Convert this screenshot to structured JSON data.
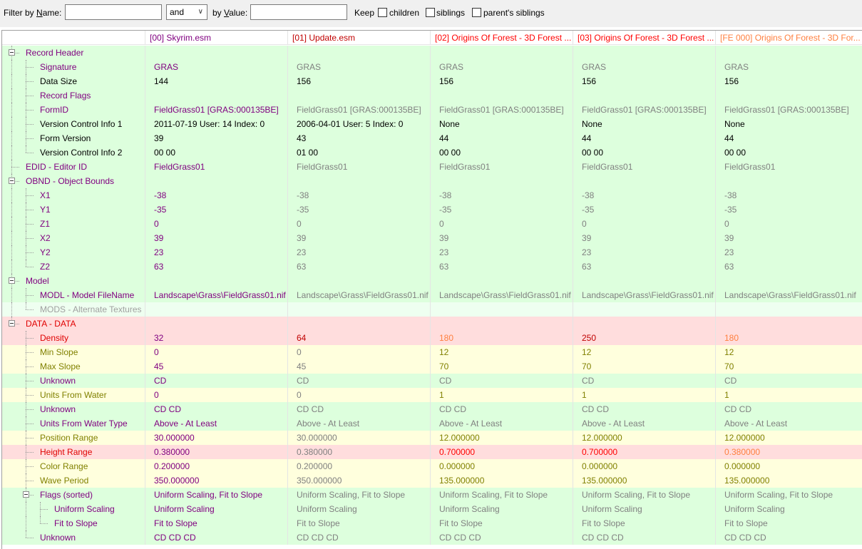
{
  "filter": {
    "name_label": "Filter by ",
    "name_label_key": "N",
    "name_label_tail": "ame:",
    "name_value": "",
    "operator": "and",
    "value_label": "by ",
    "value_label_key": "V",
    "value_label_tail": "alue:",
    "value_value": "",
    "keep_label": "Keep",
    "options": [
      {
        "label": "children",
        "checked": false
      },
      {
        "label": "siblings",
        "checked": false
      },
      {
        "label": "parent's siblings",
        "checked": false
      }
    ]
  },
  "colors": {
    "green_bg": "#ddffdd",
    "yellow_bg": "#ffffdd",
    "red_bg": "#ffdddd",
    "mods_bg": "#eefff0",
    "purple": "#800080",
    "gray": "#808080",
    "red": "#ff0000",
    "orange": "#ff8040",
    "olive": "#808000"
  },
  "columns": [
    {
      "label": "[00] Skyrim.esm",
      "color": "purple"
    },
    {
      "label": "[01] Update.esm",
      "color": "darkred"
    },
    {
      "label": "[02] Origins Of Forest - 3D Forest ...",
      "color": "red"
    },
    {
      "label": "[03] Origins Of Forest - 3D Forest ...",
      "color": "red"
    },
    {
      "label": "[FE 000] Origins Of Forest - 3D For...",
      "color": "orange"
    }
  ],
  "rows": [
    {
      "name": "Record Header",
      "level": 0,
      "expander": true,
      "bg": "green",
      "name_color": "purple",
      "values": [
        "",
        "",
        "",
        "",
        ""
      ],
      "colors": [
        "black",
        "black",
        "black",
        "black",
        "black"
      ]
    },
    {
      "name": "Signature",
      "level": 1,
      "bg": "green",
      "name_color": "purple",
      "values": [
        "GRAS",
        "GRAS",
        "GRAS",
        "GRAS",
        "GRAS"
      ],
      "colors": [
        "purple",
        "gray",
        "gray",
        "gray",
        "gray"
      ]
    },
    {
      "name": "Data Size",
      "level": 1,
      "bg": "green",
      "name_color": "black",
      "values": [
        "144",
        "156",
        "156",
        "156",
        "156"
      ],
      "colors": [
        "black",
        "black",
        "black",
        "black",
        "black"
      ]
    },
    {
      "name": "Record Flags",
      "level": 1,
      "bg": "green",
      "name_color": "purple",
      "values": [
        "",
        "",
        "",
        "",
        ""
      ],
      "colors": [
        "black",
        "black",
        "black",
        "black",
        "black"
      ]
    },
    {
      "name": "FormID",
      "level": 1,
      "bg": "green",
      "name_color": "purple",
      "values": [
        "FieldGrass01 [GRAS:000135BE]",
        "FieldGrass01 [GRAS:000135BE]",
        "FieldGrass01 [GRAS:000135BE]",
        "FieldGrass01 [GRAS:000135BE]",
        "FieldGrass01 [GRAS:000135BE]"
      ],
      "colors": [
        "purple",
        "gray",
        "gray",
        "gray",
        "gray"
      ]
    },
    {
      "name": "Version Control Info 1",
      "level": 1,
      "bg": "green",
      "name_color": "black",
      "values": [
        "2011-07-19 User: 14 Index: 0",
        "2006-04-01 User: 5 Index: 0",
        "None",
        "None",
        "None"
      ],
      "colors": [
        "black",
        "black",
        "black",
        "black",
        "black"
      ]
    },
    {
      "name": "Form Version",
      "level": 1,
      "bg": "green",
      "name_color": "black",
      "values": [
        "39",
        "43",
        "44",
        "44",
        "44"
      ],
      "colors": [
        "black",
        "black",
        "black",
        "black",
        "black"
      ]
    },
    {
      "name": "Version Control Info 2",
      "level": 1,
      "bg": "green",
      "name_color": "black",
      "values": [
        "00 00",
        "01 00",
        "00 00",
        "00 00",
        "00 00"
      ],
      "colors": [
        "black",
        "black",
        "black",
        "black",
        "black"
      ]
    },
    {
      "name": "EDID - Editor ID",
      "level": 0,
      "bg": "green",
      "name_color": "purple",
      "values": [
        "FieldGrass01",
        "FieldGrass01",
        "FieldGrass01",
        "FieldGrass01",
        "FieldGrass01"
      ],
      "colors": [
        "purple",
        "gray",
        "gray",
        "gray",
        "gray"
      ]
    },
    {
      "name": "OBND - Object Bounds",
      "level": 0,
      "expander": true,
      "bg": "green",
      "name_color": "purple",
      "values": [
        "",
        "",
        "",
        "",
        ""
      ],
      "colors": [
        "black",
        "black",
        "black",
        "black",
        "black"
      ]
    },
    {
      "name": "X1",
      "level": 1,
      "bg": "green",
      "name_color": "purple",
      "values": [
        "-38",
        "-38",
        "-38",
        "-38",
        "-38"
      ],
      "colors": [
        "purple",
        "gray",
        "gray",
        "gray",
        "gray"
      ]
    },
    {
      "name": "Y1",
      "level": 1,
      "bg": "green",
      "name_color": "purple",
      "values": [
        "-35",
        "-35",
        "-35",
        "-35",
        "-35"
      ],
      "colors": [
        "purple",
        "gray",
        "gray",
        "gray",
        "gray"
      ]
    },
    {
      "name": "Z1",
      "level": 1,
      "bg": "green",
      "name_color": "purple",
      "values": [
        "0",
        "0",
        "0",
        "0",
        "0"
      ],
      "colors": [
        "purple",
        "gray",
        "gray",
        "gray",
        "gray"
      ]
    },
    {
      "name": "X2",
      "level": 1,
      "bg": "green",
      "name_color": "purple",
      "values": [
        "39",
        "39",
        "39",
        "39",
        "39"
      ],
      "colors": [
        "purple",
        "gray",
        "gray",
        "gray",
        "gray"
      ]
    },
    {
      "name": "Y2",
      "level": 1,
      "bg": "green",
      "name_color": "purple",
      "values": [
        "23",
        "23",
        "23",
        "23",
        "23"
      ],
      "colors": [
        "purple",
        "gray",
        "gray",
        "gray",
        "gray"
      ]
    },
    {
      "name": "Z2",
      "level": 1,
      "bg": "green",
      "name_color": "purple",
      "values": [
        "63",
        "63",
        "63",
        "63",
        "63"
      ],
      "colors": [
        "purple",
        "gray",
        "gray",
        "gray",
        "gray"
      ]
    },
    {
      "name": "Model",
      "level": 0,
      "expander": true,
      "bg": "green",
      "name_color": "purple",
      "values": [
        "",
        "",
        "",
        "",
        ""
      ],
      "colors": [
        "black",
        "black",
        "black",
        "black",
        "black"
      ]
    },
    {
      "name": "MODL - Model FileName",
      "level": 1,
      "bg": "green",
      "name_color": "purple",
      "values": [
        "Landscape\\Grass\\FieldGrass01.nif",
        "Landscape\\Grass\\FieldGrass01.nif",
        "Landscape\\Grass\\FieldGrass01.nif",
        "Landscape\\Grass\\FieldGrass01.nif",
        "Landscape\\Grass\\FieldGrass01.nif"
      ],
      "colors": [
        "purple",
        "gray",
        "gray",
        "gray",
        "gray"
      ]
    },
    {
      "name": "MODS - Alternate Textures",
      "level": 1,
      "bg": "mods",
      "name_color": "mods",
      "values": [
        "",
        "",
        "",
        "",
        ""
      ],
      "colors": [
        "black",
        "black",
        "black",
        "black",
        "black"
      ]
    },
    {
      "name": "DATA - DATA",
      "level": 0,
      "expander": true,
      "bg": "red",
      "name_color": "red",
      "values": [
        "",
        "",
        "",
        "",
        ""
      ],
      "colors": [
        "black",
        "black",
        "black",
        "black",
        "black"
      ]
    },
    {
      "name": "Density",
      "level": 1,
      "bg": "red",
      "name_color": "red",
      "values": [
        "32",
        "64",
        "180",
        "250",
        "180"
      ],
      "colors": [
        "purple",
        "darkred",
        "orange",
        "darkred",
        "orange"
      ]
    },
    {
      "name": "Min Slope",
      "level": 1,
      "bg": "yellow",
      "name_color": "olive",
      "values": [
        "0",
        "0",
        "12",
        "12",
        "12"
      ],
      "colors": [
        "purple",
        "gray",
        "olive",
        "olive",
        "olive"
      ]
    },
    {
      "name": "Max Slope",
      "level": 1,
      "bg": "yellow",
      "name_color": "olive",
      "values": [
        "45",
        "45",
        "70",
        "70",
        "70"
      ],
      "colors": [
        "purple",
        "gray",
        "olive",
        "olive",
        "olive"
      ]
    },
    {
      "name": "Unknown",
      "level": 1,
      "bg": "green",
      "name_color": "purple",
      "values": [
        "CD",
        "CD",
        "CD",
        "CD",
        "CD"
      ],
      "colors": [
        "purple",
        "gray",
        "gray",
        "gray",
        "gray"
      ]
    },
    {
      "name": "Units From Water",
      "level": 1,
      "bg": "yellow",
      "name_color": "olive",
      "values": [
        "0",
        "0",
        "1",
        "1",
        "1"
      ],
      "colors": [
        "purple",
        "gray",
        "olive",
        "olive",
        "olive"
      ]
    },
    {
      "name": "Unknown",
      "level": 1,
      "bg": "green",
      "name_color": "purple",
      "values": [
        "CD CD",
        "CD CD",
        "CD CD",
        "CD CD",
        "CD CD"
      ],
      "colors": [
        "purple",
        "gray",
        "gray",
        "gray",
        "gray"
      ]
    },
    {
      "name": "Units From Water Type",
      "level": 1,
      "bg": "green",
      "name_color": "purple",
      "values": [
        "Above - At Least",
        "Above - At Least",
        "Above - At Least",
        "Above - At Least",
        "Above - At Least"
      ],
      "colors": [
        "purple",
        "gray",
        "gray",
        "gray",
        "gray"
      ]
    },
    {
      "name": "Position Range",
      "level": 1,
      "bg": "yellow",
      "name_color": "olive",
      "values": [
        "30.000000",
        "30.000000",
        "12.000000",
        "12.000000",
        "12.000000"
      ],
      "colors": [
        "purple",
        "gray",
        "olive",
        "olive",
        "olive"
      ]
    },
    {
      "name": "Height Range",
      "level": 1,
      "bg": "red",
      "name_color": "red",
      "values": [
        "0.380000",
        "0.380000",
        "0.700000",
        "0.700000",
        "0.380000"
      ],
      "colors": [
        "purple",
        "gray",
        "red",
        "red",
        "orange"
      ]
    },
    {
      "name": "Color Range",
      "level": 1,
      "bg": "yellow",
      "name_color": "olive",
      "values": [
        "0.200000",
        "0.200000",
        "0.000000",
        "0.000000",
        "0.000000"
      ],
      "colors": [
        "purple",
        "gray",
        "olive",
        "olive",
        "olive"
      ]
    },
    {
      "name": "Wave Period",
      "level": 1,
      "bg": "yellow",
      "name_color": "olive",
      "values": [
        "350.000000",
        "350.000000",
        "135.000000",
        "135.000000",
        "135.000000"
      ],
      "colors": [
        "purple",
        "gray",
        "olive",
        "olive",
        "olive"
      ]
    },
    {
      "name": "Flags (sorted)",
      "level": 1,
      "expander": true,
      "bg": "green",
      "name_color": "purple",
      "values": [
        "Uniform Scaling, Fit to Slope",
        "Uniform Scaling, Fit to Slope",
        "Uniform Scaling, Fit to Slope",
        "Uniform Scaling, Fit to Slope",
        "Uniform Scaling, Fit to Slope"
      ],
      "colors": [
        "purple",
        "gray",
        "gray",
        "gray",
        "gray"
      ]
    },
    {
      "name": "Uniform Scaling",
      "level": 2,
      "bg": "green",
      "name_color": "purple",
      "values": [
        "Uniform Scaling",
        "Uniform Scaling",
        "Uniform Scaling",
        "Uniform Scaling",
        "Uniform Scaling"
      ],
      "colors": [
        "purple",
        "gray",
        "gray",
        "gray",
        "gray"
      ]
    },
    {
      "name": "Fit to Slope",
      "level": 2,
      "bg": "green",
      "name_color": "purple",
      "values": [
        "Fit to Slope",
        "Fit to Slope",
        "Fit to Slope",
        "Fit to Slope",
        "Fit to Slope"
      ],
      "colors": [
        "purple",
        "gray",
        "gray",
        "gray",
        "gray"
      ]
    },
    {
      "name": "Unknown",
      "level": 1,
      "bg": "green",
      "name_color": "purple",
      "values": [
        "CD CD CD",
        "CD CD CD",
        "CD CD CD",
        "CD CD CD",
        "CD CD CD"
      ],
      "colors": [
        "purple",
        "gray",
        "gray",
        "gray",
        "gray"
      ]
    }
  ]
}
